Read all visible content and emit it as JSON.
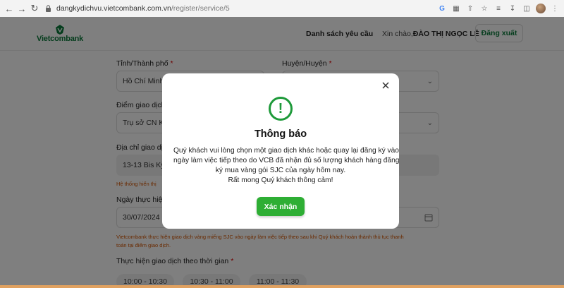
{
  "browser": {
    "url_host": "dangkydichvu.vietcombank.com.vn",
    "url_path": "/register/service/5"
  },
  "header": {
    "logo_text": "Vietcombank",
    "nav_link": "Danh sách yêu cầu",
    "greeting_prefix": "Xin chào,",
    "user_name": "ĐÀO THỊ NGỌC LỄ",
    "logout_label": "Đăng xuất"
  },
  "form": {
    "province_label": "Tỉnh/Thành phố",
    "province_value": "Hồ Chí Minh",
    "district_label": "Huyện/Huyện",
    "branch_label": "Điểm giao dịch",
    "branch_value": "Trụ sở CN Kỳ",
    "address_label": "Địa chỉ giao dịch",
    "address_value": "13-13 Bis Kỳ",
    "address_hint": "Hệ thống hiển thị",
    "date_label": "Ngày thực hiện",
    "date_value": "30/07/2024",
    "date_hint_1": "Vietcombank thực hiện giao dịch vàng miếng SJC vào ngày làm việc tiếp theo sau khi Quý khách hoàn thành thủ tục thanh",
    "date_hint_2": "toán tại điểm giao dịch.",
    "time_label": "Thực hiện giao dịch theo thời gian",
    "required_mark": "*",
    "slots": [
      "10:00 - 10:30",
      "10:30 - 11:00",
      "11:00 - 11:30"
    ]
  },
  "modal": {
    "icon": "exclamation-icon",
    "title": "Thông báo",
    "body_lines": [
      "Quý khách vui lòng chọn một giao dịch khác hoặc quay lại đăng ký vào",
      "ngày làm việc tiếp theo do VCB đã nhận đủ số lượng khách hàng đăng",
      "ký mua vàng gói SJC của ngày hôm nay.",
      "Rất mong Quý khách thông cảm!"
    ],
    "confirm_label": "Xác nhận"
  },
  "colors": {
    "brand_green": "#0b7a3b",
    "confirm_green": "#2eae34",
    "hint_orange": "#d35400"
  }
}
